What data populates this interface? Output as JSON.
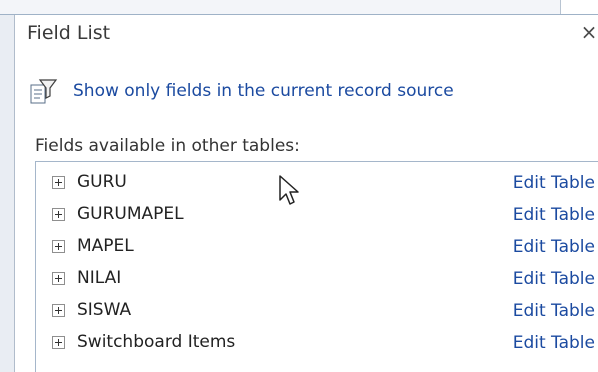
{
  "pane": {
    "title": "Field List",
    "close_glyph": "×"
  },
  "toolbar": {
    "show_only_label": "Show only fields in the current record source",
    "show_only_icon": "filter-fields-icon"
  },
  "section": {
    "label": "Fields available in other tables:"
  },
  "tables": [
    {
      "name": "GURU",
      "action": "Edit Table"
    },
    {
      "name": "GURUMAPEL",
      "action": "Edit Table"
    },
    {
      "name": "MAPEL",
      "action": "Edit Table"
    },
    {
      "name": "NILAI",
      "action": "Edit Table"
    },
    {
      "name": "SISWA",
      "action": "Edit Table"
    },
    {
      "name": "Switchboard Items",
      "action": "Edit Table"
    }
  ],
  "colors": {
    "link": "#1b4aa0",
    "text": "#222222",
    "border": "#a5b6ca"
  }
}
